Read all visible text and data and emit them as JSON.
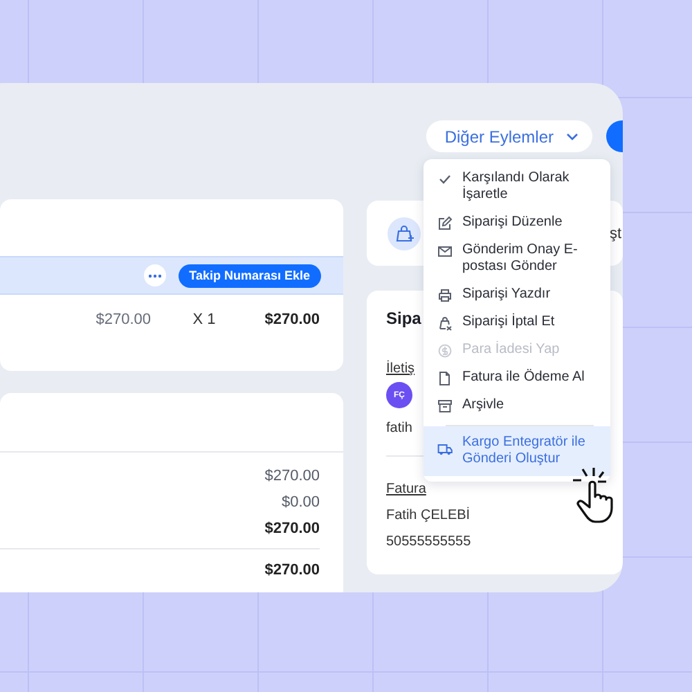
{
  "panel": {
    "actions_button": {
      "label": "Diğer Eylemler"
    },
    "items_card": {
      "tracking_button": "Takip Numarası Ekle",
      "line": {
        "price": "$270.00",
        "quantity": "X 1",
        "total": "$270.00"
      }
    },
    "summary_card": {
      "rows": [
        {
          "kind": "plain",
          "value": "$270.00"
        },
        {
          "kind": "plain",
          "value": "$0.00"
        },
        {
          "kind": "total",
          "value": "$270.00"
        },
        {
          "kind": "total",
          "value": "$270.00"
        }
      ]
    },
    "fulfill_card": {
      "text": "şt"
    },
    "customer_card": {
      "title": "Sipa",
      "contact_label": "İletiş",
      "avatar": {
        "initials": "FÇ",
        "color": "#6b4ff2"
      },
      "email": "fatih",
      "billing_label": "Fatura",
      "name": "Fatih ÇELEBİ",
      "phone": "50555555555"
    }
  },
  "menu": [
    {
      "label": "Karşılandı Olarak İşaretle",
      "disabled": false,
      "selected": false,
      "divider_before": false
    },
    {
      "label": "Siparişi Düzenle",
      "disabled": false,
      "selected": false,
      "divider_before": false
    },
    {
      "label": "Gönderim Onay E-postası Gönder",
      "disabled": false,
      "selected": false,
      "divider_before": false
    },
    {
      "label": "Siparişi Yazdır",
      "disabled": false,
      "selected": false,
      "divider_before": false
    },
    {
      "label": "Siparişi İptal Et",
      "disabled": false,
      "selected": false,
      "divider_before": false
    },
    {
      "label": "Para İadesi Yap",
      "disabled": true,
      "selected": false,
      "divider_before": false
    },
    {
      "label": "Fatura ile Ödeme Al",
      "disabled": false,
      "selected": false,
      "divider_before": false
    },
    {
      "label": "Arşivle",
      "disabled": false,
      "selected": false,
      "divider_before": false
    },
    {
      "label": "Kargo Entegratör ile Gönderi Oluştur",
      "disabled": false,
      "selected": true,
      "divider_before": true
    }
  ]
}
